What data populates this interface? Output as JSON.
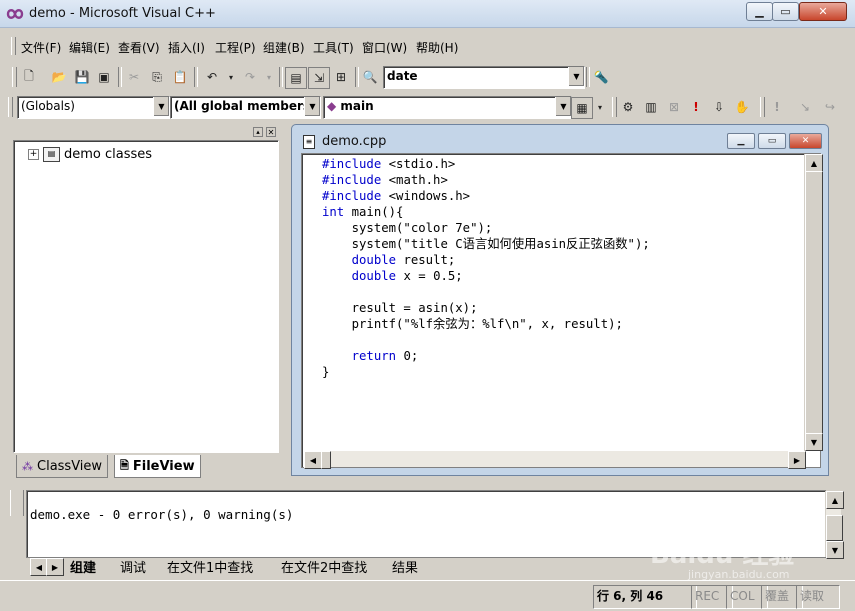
{
  "window": {
    "title": "demo - Microsoft Visual C++"
  },
  "menu": [
    "文件(F)",
    "编辑(E)",
    "查看(V)",
    "插入(I)",
    "工程(P)",
    "组建(B)",
    "工具(T)",
    "窗口(W)",
    "帮助(H)"
  ],
  "toolbar": {
    "find_combo_value": "date"
  },
  "wizardbar": {
    "class_combo": "(Globals)",
    "filter_combo": "(All global members",
    "member_combo": "main"
  },
  "workspace": {
    "tree_root": "demo classes",
    "tabs": [
      {
        "label": "ClassView"
      },
      {
        "label": "FileView"
      }
    ]
  },
  "editor": {
    "filename": "demo.cpp",
    "code_lines": [
      "#include <stdio.h>",
      "#include <math.h>",
      "#include <windows.h>",
      "int main(){",
      "    system(\"color 7e\");",
      "    system(\"title C语言如何使用asin反正弦函数\");",
      "    double result;",
      "    double x = 0.5;",
      "",
      "    result = asin(x);",
      "    printf(\"%lf余弦为：%lf\\n\", x, result);",
      "",
      "    return 0;",
      "}"
    ]
  },
  "output": {
    "text": "demo.exe - 0 error(s), 0 warning(s)",
    "tabs": [
      "组建",
      "调试",
      "在文件1中查找",
      "在文件2中查找",
      "结果"
    ]
  },
  "status": {
    "position": "行 6, 列 46",
    "rec": "REC",
    "col": "COL",
    "ovr": "覆盖",
    "read": "读取"
  },
  "watermark": {
    "brand": "Baidu 经验",
    "url": "jingyan.baidu.com"
  }
}
